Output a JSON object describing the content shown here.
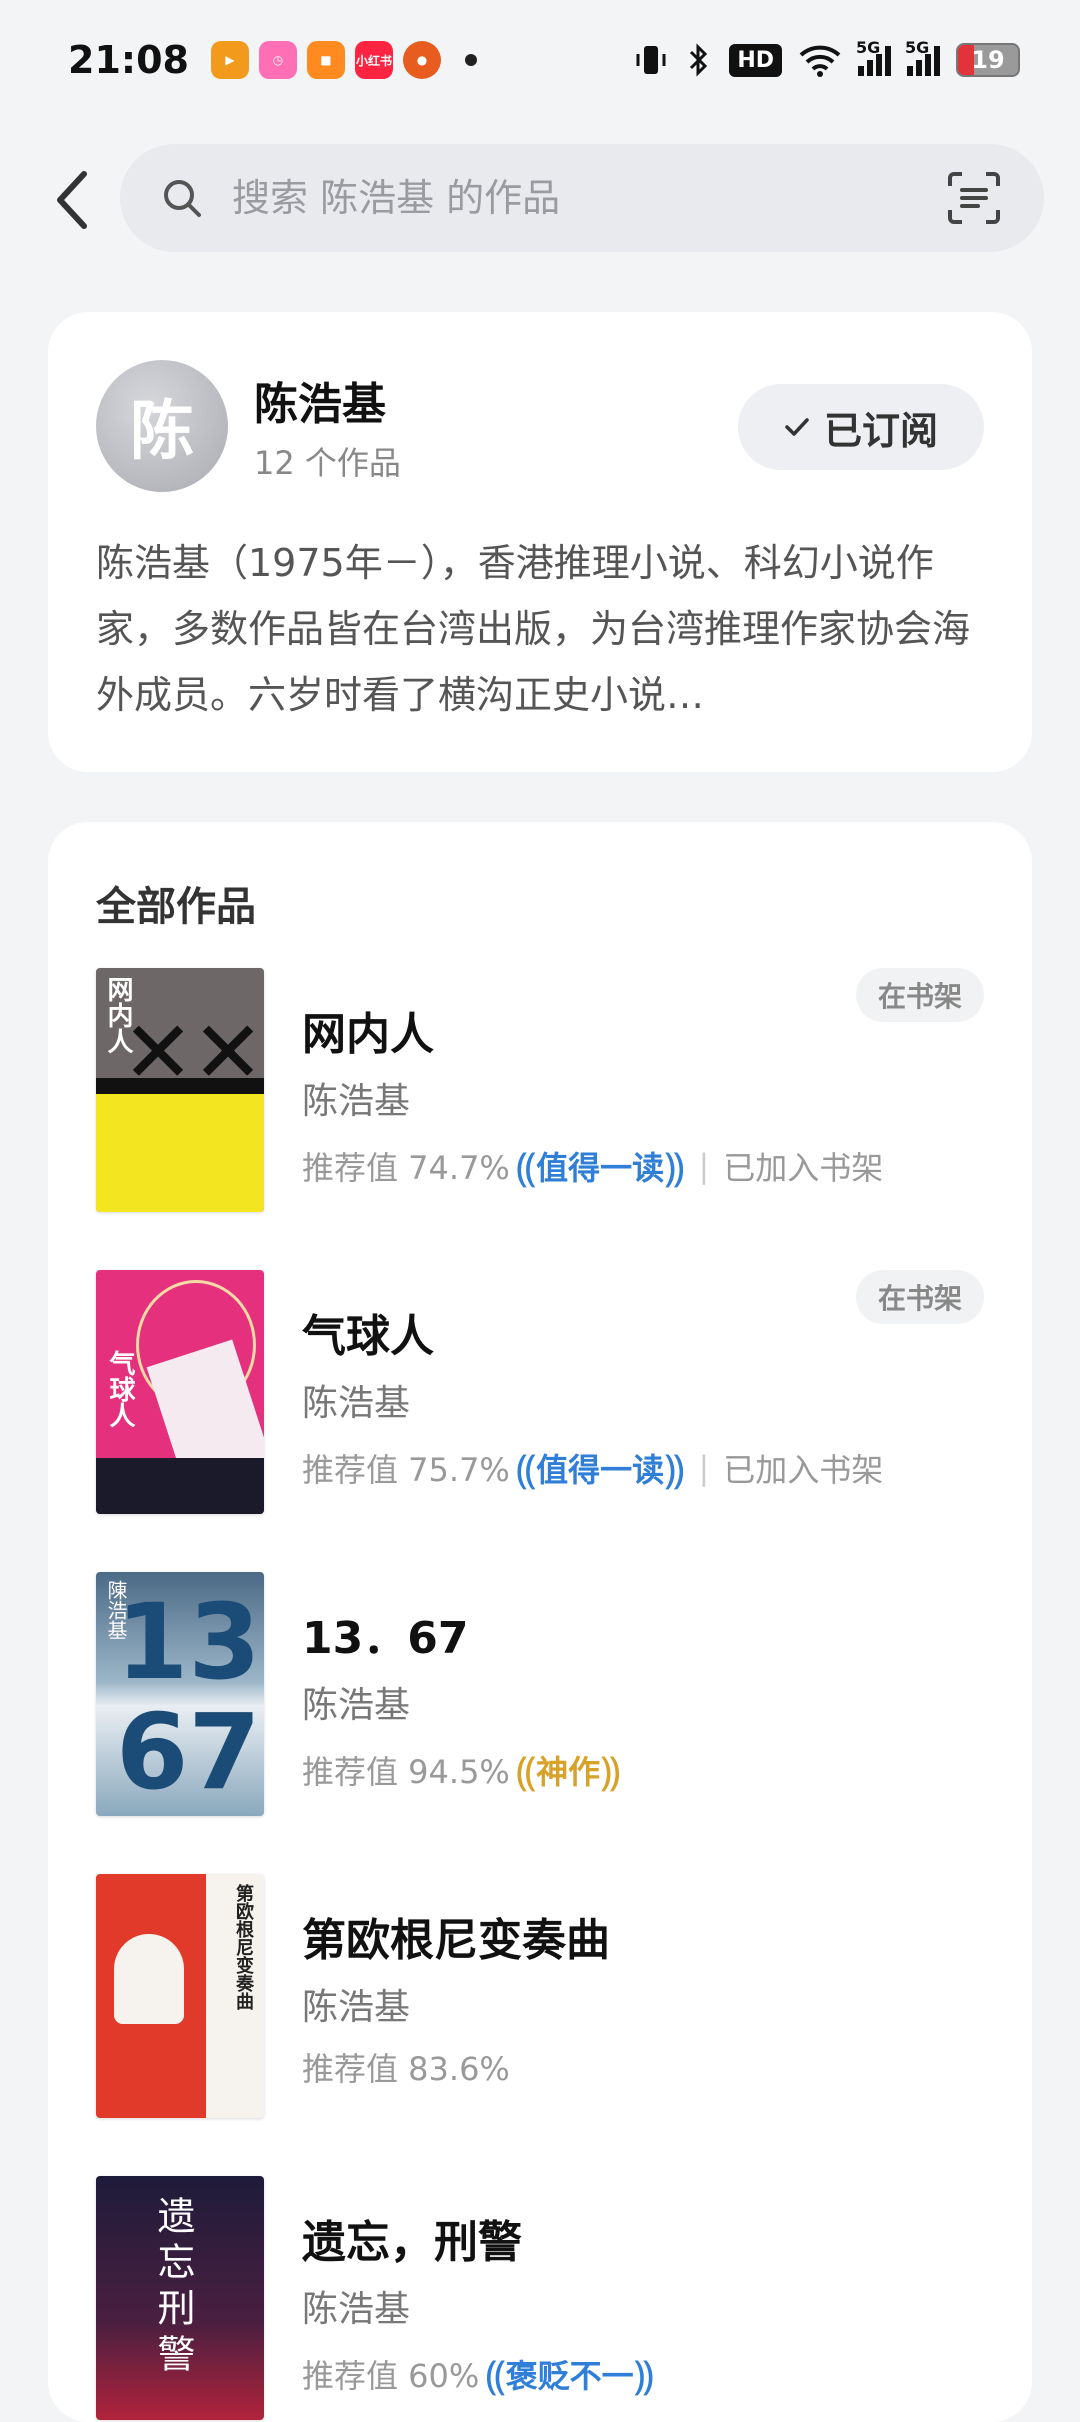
{
  "status_bar": {
    "time": "21:08",
    "apps": [
      {
        "icon": "video-app-icon",
        "color": "#f29a1c"
      },
      {
        "icon": "clock-app-icon",
        "color": "#ff6fb5"
      },
      {
        "icon": "orange-app-icon",
        "color": "#ff8a1f"
      },
      {
        "icon": "xiaohongshu-app-icon",
        "color": "#ff2442",
        "label": "小红书"
      },
      {
        "icon": "pumpkin-app-icon",
        "color": "#e85c1f"
      }
    ],
    "hd": "HD",
    "network1": "5G",
    "network2": "5G",
    "battery": "19"
  },
  "search": {
    "placeholder": "搜索 陈浩基 的作品"
  },
  "author": {
    "avatar_char": "陈",
    "name": "陈浩基",
    "works_count": "12 个作品",
    "subscribe_label": "已订阅",
    "bio": "陈浩基（1975年－），香港推理小说、科幻小说作家，多数作品皆在台湾出版，为台湾推理作家协会海外成员。六岁时看了横沟正史小说…"
  },
  "works": {
    "title": "全部作品",
    "books": [
      {
        "title": "网内人",
        "author": "陈浩基",
        "score": "推荐值 74.7%",
        "badge": "值得一读",
        "badge_color": "blue",
        "shelf_note": "已加入书架",
        "shelf_tag": "在书架",
        "cover_text": "网内人"
      },
      {
        "title": "气球人",
        "author": "陈浩基",
        "score": "推荐值 75.7%",
        "badge": "值得一读",
        "badge_color": "blue",
        "shelf_note": "已加入书架",
        "shelf_tag": "在书架",
        "cover_text": "气球人"
      },
      {
        "title": "13．67",
        "author": "陈浩基",
        "score": "推荐值 94.5%",
        "badge": "神作",
        "badge_color": "gold",
        "cover_text": "陳浩基"
      },
      {
        "title": "第欧根尼变奏曲",
        "author": "陈浩基",
        "score": "推荐值 83.6%",
        "cover_text": "第欧根尼变奏曲"
      },
      {
        "title": "遗忘，刑警",
        "author": "陈浩基",
        "score": "推荐值 60%",
        "badge": "褒贬不一",
        "badge_color": "blue",
        "cover_text": "遗忘刑警"
      }
    ]
  }
}
